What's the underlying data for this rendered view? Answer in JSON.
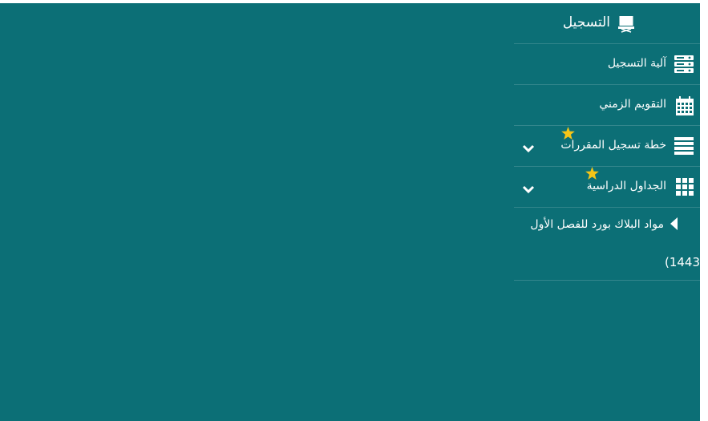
{
  "menu": {
    "title": "التسجيل",
    "title_icon": "laptop-icon",
    "items": [
      {
        "label": "آلية التسجيل",
        "icon": "server-icon",
        "expandable": false,
        "starred": false
      },
      {
        "label": "التقويم الزمني",
        "icon": "calendar-icon",
        "expandable": false,
        "starred": false
      },
      {
        "label": "خطة تسجيل المقررات",
        "icon": "list-icon",
        "expandable": true,
        "starred": true
      },
      {
        "label": "الجداول الدراسية",
        "icon": "grid-icon",
        "expandable": true,
        "starred": true
      }
    ],
    "submenu": {
      "line1": "مواد البلاك بورد للفصل الأول",
      "line2": "(1443",
      "icon": "caret-left-icon"
    }
  },
  "colors": {
    "background": "#0c6f76",
    "text": "#ffffff",
    "star": "#f5c518",
    "divider": "rgba(255,255,255,0.16)"
  }
}
